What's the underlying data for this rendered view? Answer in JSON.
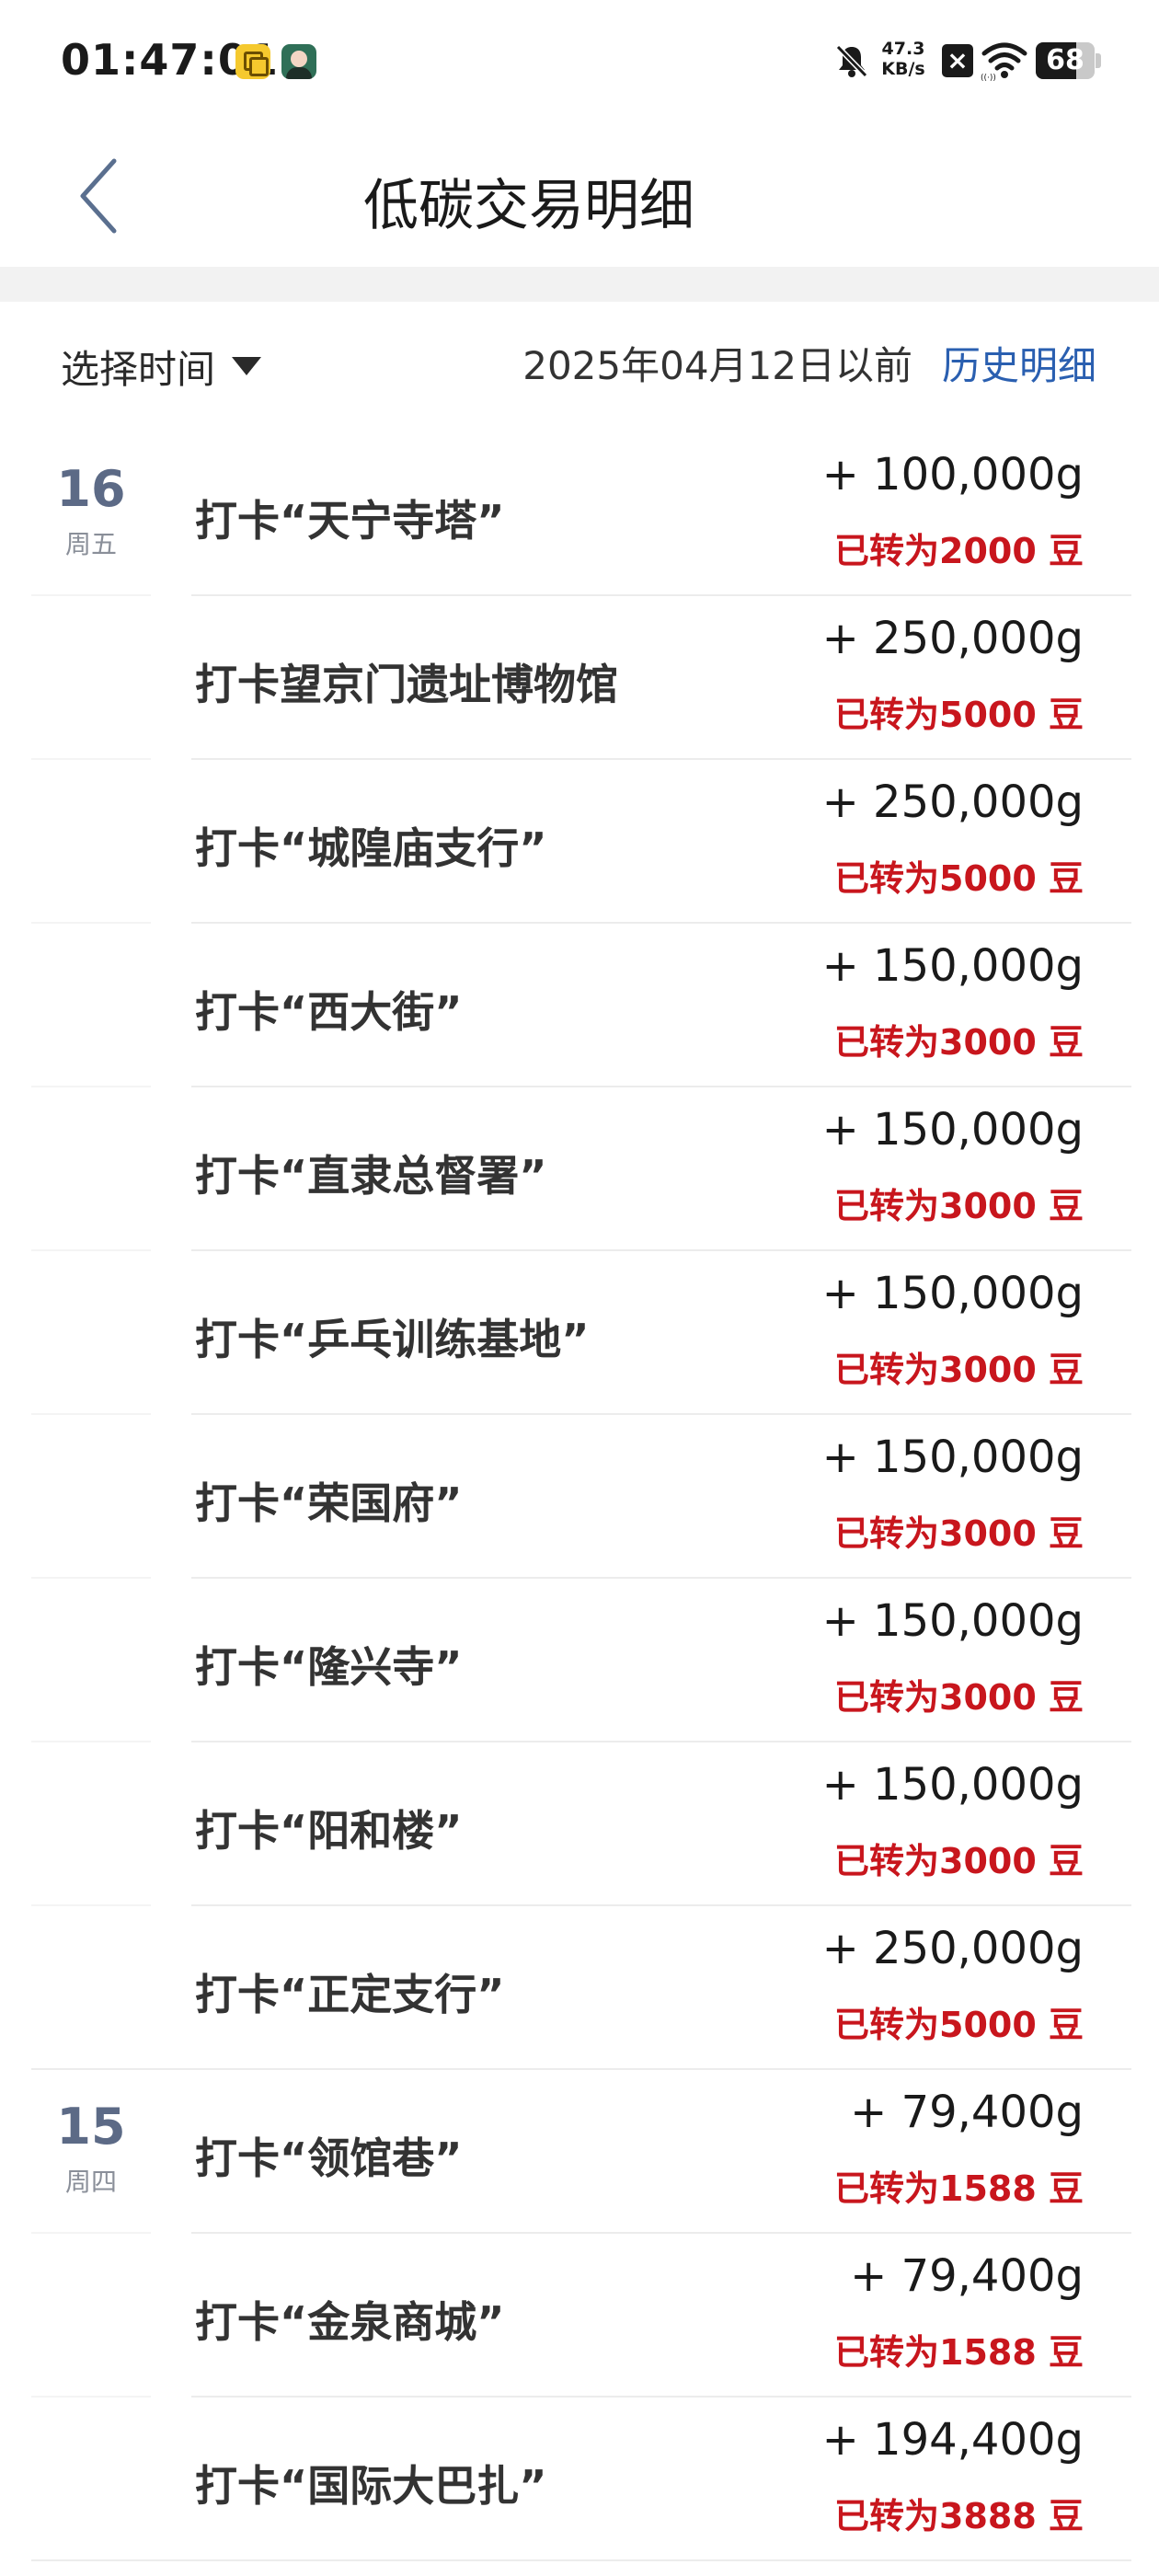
{
  "status_bar": {
    "time": "01:47:01",
    "net_speed_value": "47.3",
    "net_speed_unit": "KB/s",
    "battery_level": "68",
    "battery_fraction": 0.68
  },
  "nav": {
    "title": "低碳交易明细"
  },
  "filter": {
    "time_select_label": "选择时间",
    "date_note": "2025年04月12日以前",
    "history_link": "历史明细"
  },
  "transactions": [
    {
      "day": "16",
      "weekday": "周五",
      "title": "打卡“天宁寺塔”",
      "amount": "+ 100,000g",
      "converted": "已转为2000 豆"
    },
    {
      "day": "",
      "weekday": "",
      "title": "打卡望京门遗址博物馆",
      "amount": "+ 250,000g",
      "converted": "已转为5000 豆"
    },
    {
      "day": "",
      "weekday": "",
      "title": "打卡“城隍庙支行”",
      "amount": "+ 250,000g",
      "converted": "已转为5000 豆"
    },
    {
      "day": "",
      "weekday": "",
      "title": "打卡“西大街”",
      "amount": "+ 150,000g",
      "converted": "已转为3000 豆"
    },
    {
      "day": "",
      "weekday": "",
      "title": "打卡“直隶总督署”",
      "amount": "+ 150,000g",
      "converted": "已转为3000 豆"
    },
    {
      "day": "",
      "weekday": "",
      "title": "打卡“乒乓训练基地”",
      "amount": "+ 150,000g",
      "converted": "已转为3000 豆"
    },
    {
      "day": "",
      "weekday": "",
      "title": "打卡“荣国府”",
      "amount": "+ 150,000g",
      "converted": "已转为3000 豆"
    },
    {
      "day": "",
      "weekday": "",
      "title": "打卡“隆兴寺”",
      "amount": "+ 150,000g",
      "converted": "已转为3000 豆"
    },
    {
      "day": "",
      "weekday": "",
      "title": "打卡“阳和楼”",
      "amount": "+ 150,000g",
      "converted": "已转为3000 豆"
    },
    {
      "day": "",
      "weekday": "",
      "title": "打卡“正定支行”",
      "amount": "+ 250,000g",
      "converted": "已转为5000 豆"
    },
    {
      "day": "15",
      "weekday": "周四",
      "title": "打卡“领馆巷”",
      "amount": "+ 79,400g",
      "converted": "已转为1588 豆"
    },
    {
      "day": "",
      "weekday": "",
      "title": "打卡“金泉商城”",
      "amount": "+ 79,400g",
      "converted": "已转为1588 豆"
    },
    {
      "day": "",
      "weekday": "",
      "title": "打卡“国际大巴扎”",
      "amount": "+ 194,400g",
      "converted": "已转为3888 豆"
    }
  ]
}
